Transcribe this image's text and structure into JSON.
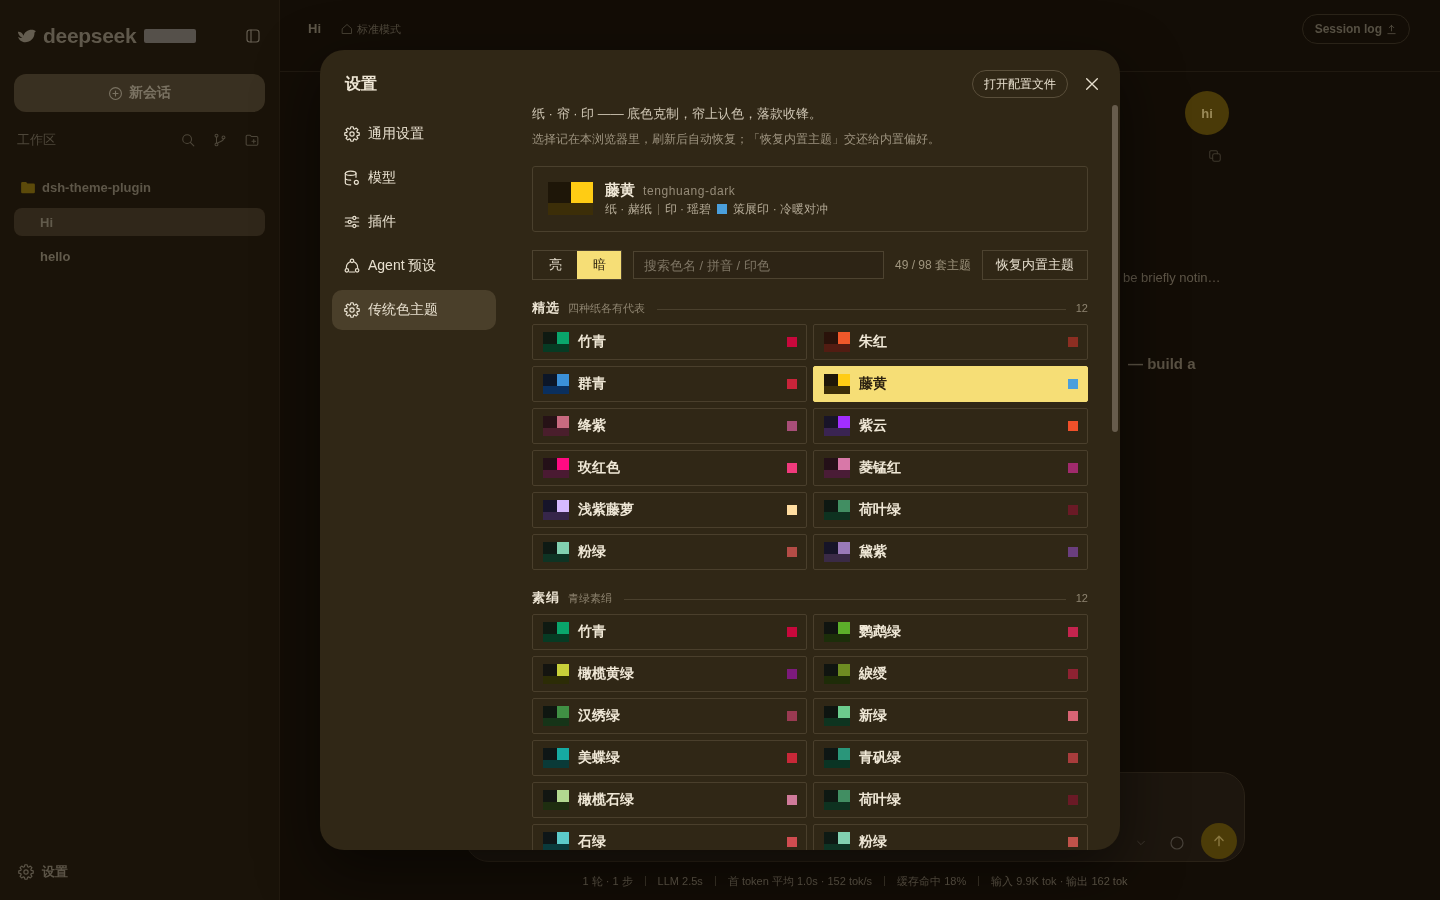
{
  "backdrop": {
    "sidebar": {
      "logo": "deepseek",
      "new_chat": "新会话",
      "workspace_label": "工作区",
      "folder": "dsh-theme-plugin",
      "sessions": [
        {
          "title": "Hi",
          "selected": true
        },
        {
          "title": "hello",
          "selected": false
        }
      ],
      "settings_label": "设置"
    },
    "header": {
      "title": "Hi",
      "mode": "标准模式",
      "session_log": "Session log"
    },
    "chat": {
      "avatar": "hi",
      "fragments": [
        {
          "kind": "note",
          "text": "be briefly notin…"
        },
        {
          "kind": "heading",
          "text": "— build a"
        }
      ]
    },
    "status_bar": [
      "1 轮 · 1 步",
      "LLM 2.5s",
      "首 token 平均 1.0s · 152 tok/s",
      "缓存命中 18%",
      "输入 9.9K tok · 输出 162 tok"
    ]
  },
  "settings": {
    "title": "设置",
    "nav": [
      {
        "kind": "general",
        "label": "通用设置",
        "selected": false
      },
      {
        "kind": "model",
        "label": "模型",
        "selected": false
      },
      {
        "kind": "plugin",
        "label": "插件",
        "selected": false
      },
      {
        "kind": "agent",
        "label": "Agent 预设",
        "selected": false
      },
      {
        "kind": "theme",
        "label": "传统色主题",
        "selected": true
      }
    ],
    "open_config": "打开配置文件",
    "intro": "纸 · 帘 · 印 —— 底色克制，帘上认色，落款收锋。",
    "note": "选择记在本浏览器里，刷新后自动恢复；「恢复内置主题」交还给内置偏好。",
    "current": {
      "name": "藤黄",
      "slug": "tenghuang-dark",
      "paper": "纸 · 赭纸",
      "seal": "印 · 瑶碧",
      "style": "策展印 · 冷暖对冲",
      "swatch": [
        {
          "color": "#1e1608"
        },
        {
          "color": "#ffcc14"
        },
        {
          "color": "#3c2e08"
        }
      ],
      "color": "#4a9fdc"
    },
    "modes": [
      {
        "label": "亮",
        "selected": false
      },
      {
        "label": "暗",
        "selected": true
      }
    ],
    "search": {
      "placeholder": "搜索色名 / 拼音 / 印色"
    },
    "count": "49 / 98 套主题",
    "restore": "恢复内置主题",
    "sections": [
      {
        "title": "精选",
        "subtitle": "四种纸各有代表",
        "count": "12",
        "themes": [
          {
            "name": "竹青",
            "swatch": [
              {
                "color": "#0f1a12"
              },
              {
                "color": "#0aa56c"
              },
              {
                "color": "#063b24"
              }
            ],
            "color": "#c8083c",
            "selected": false
          },
          {
            "name": "朱红",
            "swatch": [
              {
                "color": "#2a120a"
              },
              {
                "color": "#f0582a"
              },
              {
                "color": "#521c12"
              }
            ],
            "color": "#8c2e22",
            "selected": false
          },
          {
            "name": "群青",
            "swatch": [
              {
                "color": "#0c1628"
              },
              {
                "color": "#3b90d8"
              },
              {
                "color": "#0a2f5e"
              }
            ],
            "color": "#c8243a",
            "selected": false
          },
          {
            "name": "藤黄",
            "swatch": [
              {
                "color": "#1e1608"
              },
              {
                "color": "#ffcc14"
              },
              {
                "color": "#3c2e08"
              }
            ],
            "color": "#4a9fdc",
            "selected": true
          },
          {
            "name": "绛紫",
            "swatch": [
              {
                "color": "#261216"
              },
              {
                "color": "#c86a80"
              },
              {
                "color": "#4a1e2c"
              }
            ],
            "color": "#a84e78",
            "selected": false
          },
          {
            "name": "紫云",
            "swatch": [
              {
                "color": "#181428"
              },
              {
                "color": "#a22eff"
              },
              {
                "color": "#3a2452"
              }
            ],
            "color": "#f0502a",
            "selected": false
          },
          {
            "name": "玫红色",
            "swatch": [
              {
                "color": "#241018"
              },
              {
                "color": "#ff0a82"
              },
              {
                "color": "#4a1a32"
              }
            ],
            "color": "#f03a7c",
            "selected": false
          },
          {
            "name": "菱锰红",
            "swatch": [
              {
                "color": "#241018"
              },
              {
                "color": "#d878a8"
              },
              {
                "color": "#4a1c36"
              }
            ],
            "color": "#a02a6c",
            "selected": false
          },
          {
            "name": "浅紫藤萝",
            "swatch": [
              {
                "color": "#16142a"
              },
              {
                "color": "#d6baff"
              },
              {
                "color": "#36264a"
              }
            ],
            "color": "#ffdca0",
            "selected": false
          },
          {
            "name": "荷叶绿",
            "swatch": [
              {
                "color": "#0e1812"
              },
              {
                "color": "#418e62"
              },
              {
                "color": "#0e3220"
              }
            ],
            "color": "#6a1a26",
            "selected": false
          },
          {
            "name": "粉绿",
            "swatch": [
              {
                "color": "#0e1a14"
              },
              {
                "color": "#82d0b0"
              },
              {
                "color": "#0e3424"
              }
            ],
            "color": "#b44c46",
            "selected": false
          },
          {
            "name": "黛紫",
            "swatch": [
              {
                "color": "#161428"
              },
              {
                "color": "#9a7ab8"
              },
              {
                "color": "#3a2a46"
              }
            ],
            "color": "#6a3e7e",
            "selected": false
          }
        ]
      },
      {
        "title": "素绢",
        "subtitle": "青绿素绢",
        "count": "12",
        "themes": [
          {
            "name": "竹青",
            "swatch": [
              {
                "color": "#0f1a12"
              },
              {
                "color": "#0aa56c"
              },
              {
                "color": "#063b24"
              }
            ],
            "color": "#c8083c",
            "selected": false
          },
          {
            "name": "鹦鹉绿",
            "swatch": [
              {
                "color": "#101410"
              },
              {
                "color": "#5cae2a"
              },
              {
                "color": "#1c2e0a"
              }
            ],
            "color": "#c4244e",
            "selected": false
          },
          {
            "name": "橄榄黄绿",
            "swatch": [
              {
                "color": "#141410"
              },
              {
                "color": "#c8d03a"
              },
              {
                "color": "#2c2c06"
              }
            ],
            "color": "#7c1a7c",
            "selected": false
          },
          {
            "name": "綟绶",
            "swatch": [
              {
                "color": "#101410"
              },
              {
                "color": "#6e8c22"
              },
              {
                "color": "#1e2c08"
              }
            ],
            "color": "#8e2232",
            "selected": false
          },
          {
            "name": "汉绣绿",
            "swatch": [
              {
                "color": "#0f1610"
              },
              {
                "color": "#409044"
              },
              {
                "color": "#163418"
              }
            ],
            "color": "#9a3a52",
            "selected": false
          },
          {
            "name": "新绿",
            "swatch": [
              {
                "color": "#0e1410"
              },
              {
                "color": "#6ccc8e"
              },
              {
                "color": "#0e3420"
              }
            ],
            "color": "#d86474",
            "selected": false
          },
          {
            "name": "美蝶绿",
            "swatch": [
              {
                "color": "#0e1616"
              },
              {
                "color": "#16aaa2"
              },
              {
                "color": "#0a3a38"
              }
            ],
            "color": "#c82838",
            "selected": false
          },
          {
            "name": "青矾绿",
            "swatch": [
              {
                "color": "#0e1614"
              },
              {
                "color": "#2a967a"
              },
              {
                "color": "#0a3424"
              }
            ],
            "color": "#a83c3c",
            "selected": false
          },
          {
            "name": "橄榄石绿",
            "swatch": [
              {
                "color": "#121612"
              },
              {
                "color": "#b2d890"
              },
              {
                "color": "#1e2e10"
              }
            ],
            "color": "#d07a9a",
            "selected": false
          },
          {
            "name": "荷叶绿",
            "swatch": [
              {
                "color": "#0e1812"
              },
              {
                "color": "#418e62"
              },
              {
                "color": "#0e3220"
              }
            ],
            "color": "#6a1a26",
            "selected": false
          },
          {
            "name": "石绿",
            "swatch": [
              {
                "color": "#0e1618"
              },
              {
                "color": "#5ccaca"
              },
              {
                "color": "#0a3a3c"
              }
            ],
            "color": "#d04c50",
            "selected": false
          },
          {
            "name": "粉绿",
            "swatch": [
              {
                "color": "#0e1a14"
              },
              {
                "color": "#82d0b0"
              },
              {
                "color": "#0e3424"
              }
            ],
            "color": "#c0524a",
            "selected": false
          }
        ]
      }
    ]
  }
}
